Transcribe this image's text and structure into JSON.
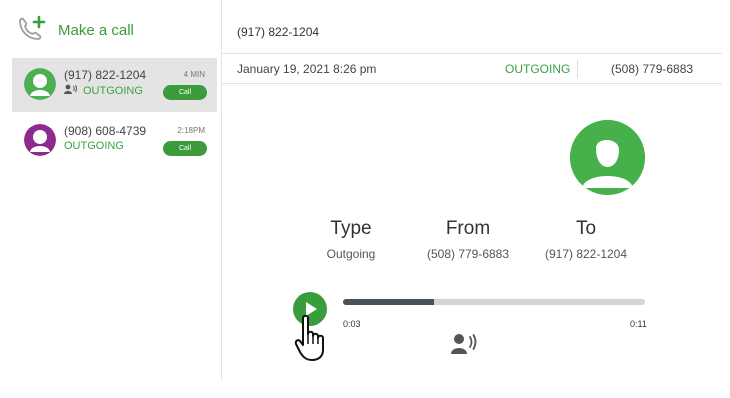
{
  "sidebar": {
    "make_call_label": "Make a call",
    "calls": [
      {
        "number": "(917) 822-1204",
        "status": "OUTGOING",
        "time": "4 MIN",
        "button": "Call",
        "avatar_color": "#4caf50",
        "active": true
      },
      {
        "number": "(908) 608-4739",
        "status": "OUTGOING",
        "time": "2:18PM",
        "button": "Call",
        "avatar_color": "#8e2a8e",
        "active": false
      }
    ]
  },
  "header": {
    "title": "(917) 822-1204"
  },
  "meta": {
    "date": "January 19, 2021 8:26 pm",
    "type": "OUTGOING",
    "number": "(508) 779-6883"
  },
  "details": {
    "type_label": "Type",
    "type_value": "Outgoing",
    "from_label": "From",
    "from_value": "(508) 779-6883",
    "to_label": "To",
    "to_value": "(917) 822-1204"
  },
  "player": {
    "current": "0:03",
    "total": "0:11",
    "progress": 0.3
  },
  "colors": {
    "accent": "#3c9b3a",
    "progress_fill": "#4a5258",
    "track": "#d1d5d9"
  }
}
